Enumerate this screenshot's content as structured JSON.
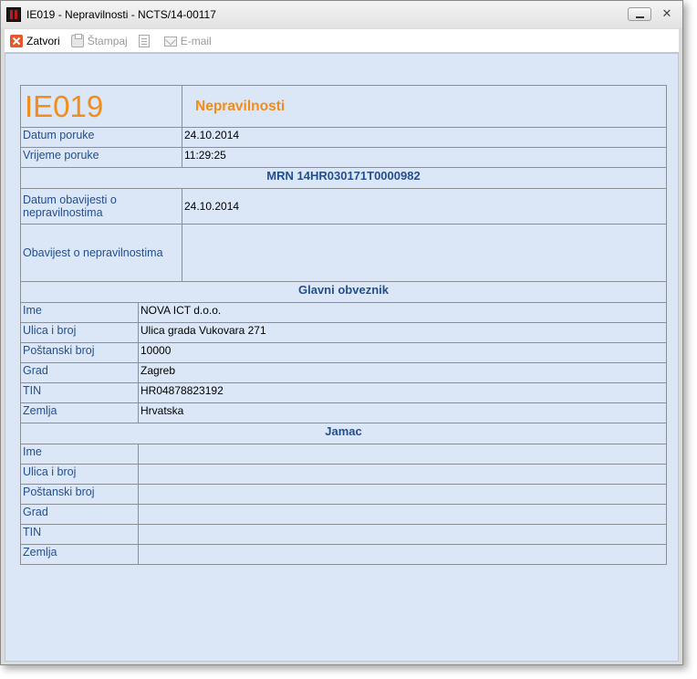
{
  "window": {
    "title": "IE019 - Nepravilnosti - NCTS/14-00117",
    "close_glyph": "✕"
  },
  "toolbar": {
    "close_label": "Zatvori",
    "print_label": "Štampaj",
    "email_label": "E-mail"
  },
  "document": {
    "code": "IE019",
    "title": "Nepravilnosti",
    "message_date_label": "Datum poruke",
    "message_date": "24.10.2014",
    "message_time_label": "Vrijeme poruke",
    "message_time": "11:29:25",
    "mrn": "MRN 14HR030171T0000982",
    "notice_date_label": "Datum obavijesti o nepravilnostima",
    "notice_date": "24.10.2014",
    "notice_label": "Obavijest o nepravilnostima",
    "notice_value": ""
  },
  "principal": {
    "section_title": "Glavni obveznik",
    "name_label": "Ime",
    "name": "NOVA ICT d.o.o.",
    "street_label": "Ulica i broj",
    "street": "Ulica grada Vukovara 271",
    "postcode_label": "Poštanski broj",
    "postcode": "10000",
    "city_label": "Grad",
    "city": "Zagreb",
    "tin_label": "TIN",
    "tin": "HR04878823192",
    "country_label": "Zemlja",
    "country": "Hrvatska"
  },
  "guarantor": {
    "section_title": "Jamac",
    "name_label": "Ime",
    "name": "",
    "street_label": "Ulica i broj",
    "street": "",
    "postcode_label": "Poštanski broj",
    "postcode": "",
    "city_label": "Grad",
    "city": "",
    "tin_label": "TIN",
    "tin": "",
    "country_label": "Zemlja",
    "country": ""
  },
  "colors": {
    "label_blue": "#244f8f",
    "accent_orange": "#f28c1a",
    "content_bg": "#dbe7f6"
  }
}
